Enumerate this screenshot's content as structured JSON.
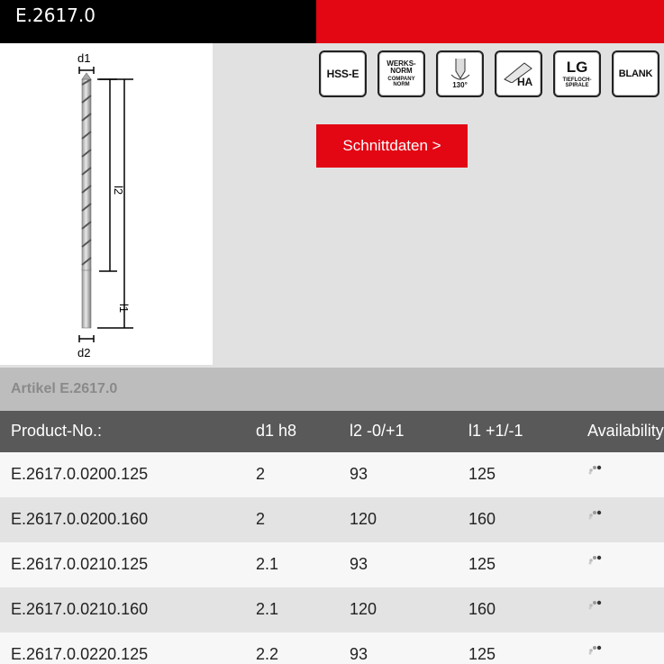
{
  "header": {
    "title": "E.2617.0"
  },
  "drawing": {
    "labels": {
      "d1": "d1",
      "l2": "l2",
      "l1": "l1",
      "d2": "d2"
    }
  },
  "icons": [
    {
      "name": "hss-e-icon",
      "lines": [
        "HSS-E"
      ]
    },
    {
      "name": "werksnorm-icon",
      "lines": [
        "WERKS-",
        "NORM",
        "COMPANY",
        "NORM"
      ]
    },
    {
      "name": "point-angle-icon",
      "lines": [
        "130°"
      ]
    },
    {
      "name": "ha-shank-icon",
      "lines": [
        "HA"
      ]
    },
    {
      "name": "lg-deep-hole-icon",
      "lines": [
        "LG",
        "TIEFLOCH-",
        "SPIRALE"
      ]
    },
    {
      "name": "blank-icon",
      "lines": [
        "BLANK"
      ]
    }
  ],
  "buttons": {
    "cutting_data": "Schnittdaten >"
  },
  "section": {
    "title": "Artikel E.2617.0"
  },
  "table": {
    "columns": [
      "Product-No.:",
      "d1 h8",
      "l2 -0/+1",
      "l1 +1/-1",
      "Availability"
    ],
    "rows": [
      [
        "E.2617.0.0200.125",
        "2",
        "93",
        "125"
      ],
      [
        "E.2617.0.0200.160",
        "2",
        "120",
        "160"
      ],
      [
        "E.2617.0.0210.125",
        "2.1",
        "93",
        "125"
      ],
      [
        "E.2617.0.0210.160",
        "2.1",
        "120",
        "160"
      ],
      [
        "E.2617.0.0220.125",
        "2.2",
        "93",
        "125"
      ]
    ]
  },
  "colors": {
    "brand_red": "#e30613",
    "header_black": "#000000",
    "table_header": "#595959"
  }
}
